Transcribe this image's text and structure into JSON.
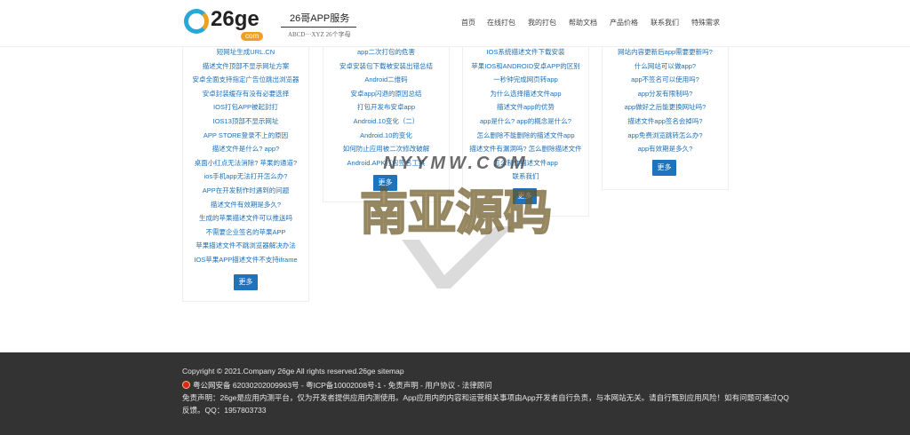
{
  "header": {
    "logo_text": "26ge",
    "logo_com": "com",
    "brand_title": "26哥APP服务",
    "brand_subtitle": "ABCD···XYZ 26个字母",
    "nav": [
      "首页",
      "在线打包",
      "我的打包",
      "帮助文档",
      "产品价格",
      "联系我们",
      "特殊需求"
    ]
  },
  "columns": [
    {
      "items": [
        "短网址生成URL.CN",
        "描述文件顶部不显示网址方案",
        "安卓全面支持指定广告位跳出浏览器",
        "安卓封装缓存有没有必要选择",
        "IOS打包APP被起封打",
        "IOS13顶部不显示网址",
        "APP STORE登录不上的原因",
        "描述文件是什么? app?",
        "桌面小红点无法消除? 苹果的通道?",
        "ios手机app无法打开怎么办?",
        "APP在开发制作时遇到的问题",
        "描述文件有效期是多久?",
        "生成的苹果描述文件可以推送吗",
        "不需要企业签名的苹果APP",
        "苹果描述文件不跳浏览器解决办法",
        "IOS苹果APP描述文件不支持iframe"
      ],
      "more": "更多"
    },
    {
      "items": [
        "app二次打包的危害",
        "安卓安装包下载被安装出错总结",
        "Android二维码",
        "安卓app闪退的原因总结",
        "打包开发布安卓app",
        "Android.10变化（二）",
        "Android.10的变化",
        "如何防止应用被二次修改破解",
        "Android.APK打包签名工具"
      ],
      "more": "更多"
    },
    {
      "items": [
        "IOS系统描述文件下载安装",
        "苹果IOS和ANDROID安卓APP的区别",
        "一秒钟完成网页转app",
        "为什么选择描述文件app",
        "描述文件app的优势",
        "app是什么? app的概念是什么?",
        "怎么删除不能删除的描述文件app",
        "描述文件有漏洞吗? 怎么删除描述文件",
        "怎么制作描述文件app",
        "联系我们"
      ],
      "more": "更多"
    },
    {
      "items": [
        "网站内容更新后app需要更新吗?",
        "什么网站可以做app?",
        "app不签名可以使用吗?",
        "app分发有限制吗?",
        "app做好之后能更换网址吗?",
        "描述文件app签名会掉吗?",
        "app免费浏览跳转怎么办?",
        "app有效期是多久?"
      ],
      "more": "更多"
    }
  ],
  "watermark": {
    "top_text": "NYYMW.COM",
    "main_text": "南亚源码"
  },
  "footer": {
    "copyright": "Copyright © 2021.Company 26ge All rights reserved.26ge sitemap",
    "icp": "粤公网安备 62030202009963号 - 粤ICP备10002008号-1 - 免责声明 - 用户协议 - 法律顾问",
    "disclaimer_line1": "免责声明：26ge是应用内测平台，仅为开发者提供应用内测使用。App应用内的内容和运营相关事项由App开发者自行负责，与本网站无关。请自行甄别应用风险！如有问题可通过QQ",
    "disclaimer_line2": "反馈。QQ：1957803733"
  },
  "colors": {
    "link": "#1e6fb8",
    "button": "#1e73be",
    "footer_bg": "#333333",
    "accent": "#f0a020"
  }
}
